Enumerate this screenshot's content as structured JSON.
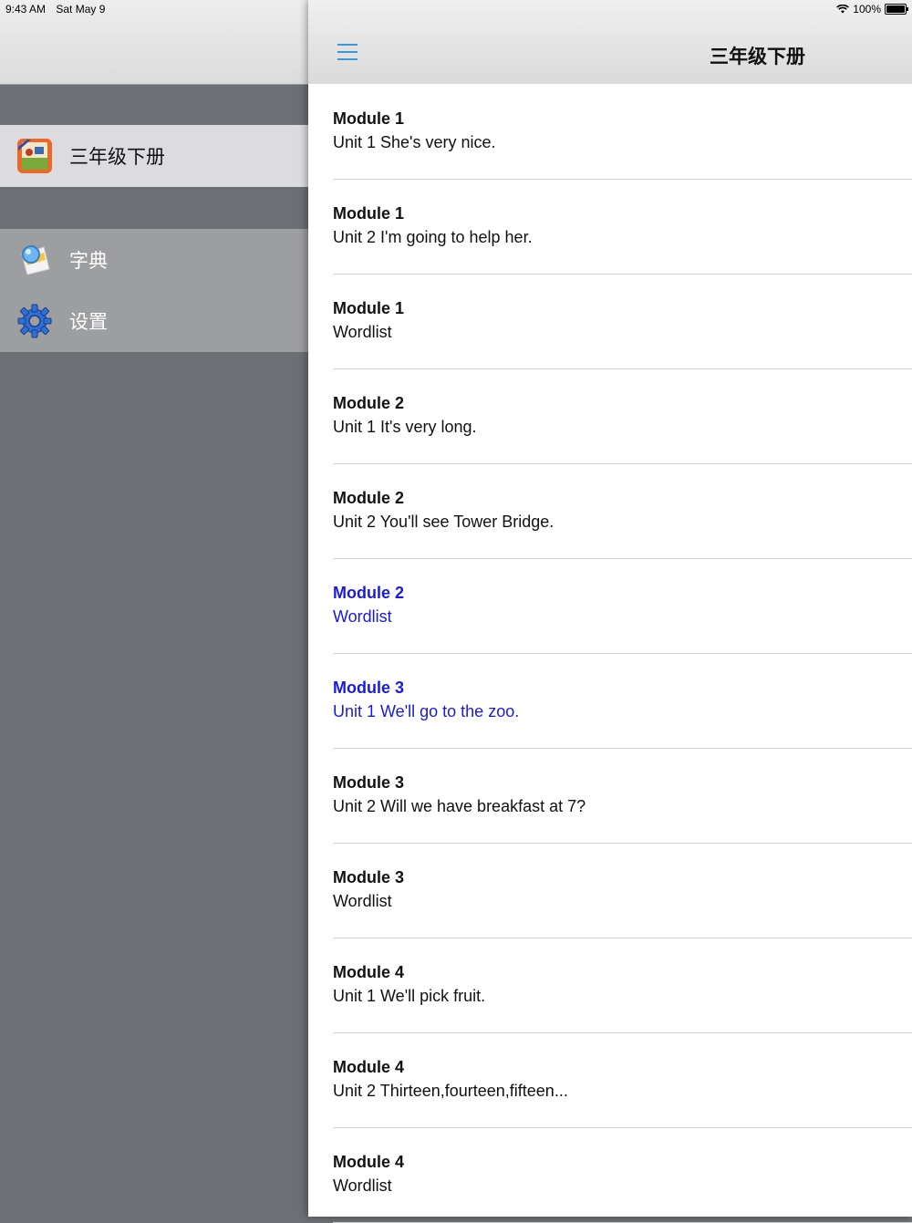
{
  "status_bar": {
    "time": "9:43 AM",
    "date": "Sat May 9",
    "battery": "100%"
  },
  "sidebar": {
    "items": [
      {
        "label": "三年级下册",
        "icon": "book-cover-icon"
      },
      {
        "label": "字典",
        "icon": "dictionary-icon"
      },
      {
        "label": "设置",
        "icon": "gear-icon"
      }
    ]
  },
  "navbar": {
    "title": "三年级下册",
    "menu_icon": "hamburger-menu-icon"
  },
  "colors": {
    "accent": "#3a9ad9",
    "active_text": "#1a1adc"
  },
  "lessons": [
    {
      "title": "Module 1",
      "subtitle": "Unit 1 She's very nice."
    },
    {
      "title": "Module 1",
      "subtitle": "Unit 2 I'm going to help her."
    },
    {
      "title": "Module 1",
      "subtitle": "Wordlist"
    },
    {
      "title": "Module 2",
      "subtitle": "Unit 1 It's very long."
    },
    {
      "title": "Module 2",
      "subtitle": "Unit 2 You'll see Tower Bridge."
    },
    {
      "title": "Module 2",
      "subtitle": "Wordlist"
    },
    {
      "title": "Module 3",
      "subtitle": "Unit 1 We'll go to the zoo."
    },
    {
      "title": "Module 3",
      "subtitle": "Unit 2 Will we have breakfast at 7?"
    },
    {
      "title": "Module 3",
      "subtitle": "Wordlist"
    },
    {
      "title": "Module 4",
      "subtitle": "Unit 1 We'll pick fruit."
    },
    {
      "title": "Module 4",
      "subtitle": "Unit 2 Thirteen,fourteen,fifteen..."
    },
    {
      "title": "Module 4",
      "subtitle": "Wordlist"
    }
  ]
}
